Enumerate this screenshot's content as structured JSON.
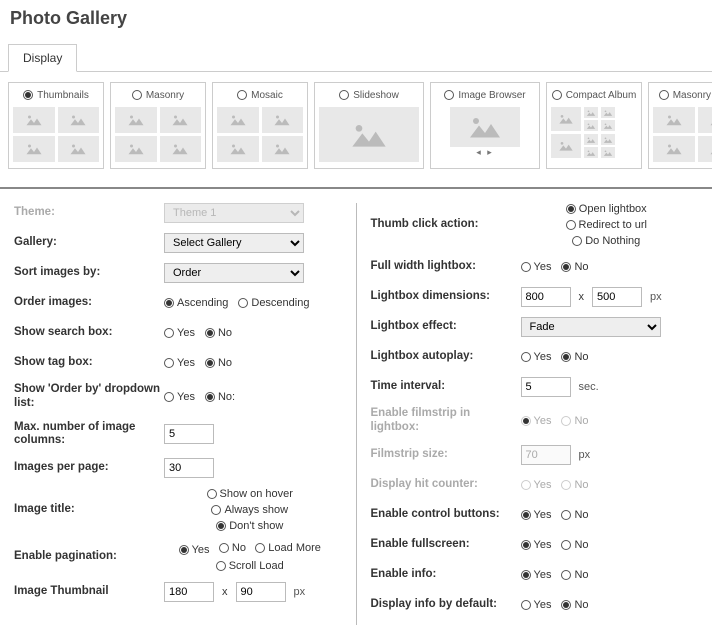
{
  "header": {
    "title": "Photo Gallery"
  },
  "tabs": {
    "display": "Display"
  },
  "views": [
    {
      "label": "Thumbnails",
      "type": "grid",
      "selected": true
    },
    {
      "label": "Masonry",
      "type": "grid",
      "selected": false
    },
    {
      "label": "Mosaic",
      "type": "grid",
      "selected": false
    },
    {
      "label": "Slideshow",
      "type": "slideshow",
      "selected": false
    },
    {
      "label": "Image Browser",
      "type": "browser",
      "selected": false
    },
    {
      "label": "Compact Album",
      "type": "compact",
      "selected": false
    },
    {
      "label": "Masonry Albu",
      "type": "grid",
      "selected": false
    }
  ],
  "left": {
    "theme_label": "Theme:",
    "theme_value": "Theme 1",
    "gallery_label": "Gallery:",
    "gallery_value": "Select Gallery",
    "sort_label": "Sort images by:",
    "sort_value": "Order",
    "order_label": "Order images:",
    "order_asc": "Ascending",
    "order_desc": "Descending",
    "search_label": "Show search box:",
    "tag_label": "Show tag box:",
    "orderby_label": "Show 'Order by' dropdown list:",
    "maxcols_label": "Max. number of image columns:",
    "maxcols_value": "5",
    "perpage_label": "Images per page:",
    "perpage_value": "30",
    "imgtitle_label": "Image title:",
    "imgtitle_hover": "Show on hover",
    "imgtitle_always": "Always show",
    "imgtitle_dont": "Don't show",
    "pagination_label": "Enable pagination:",
    "pagination_loadmore": "Load More",
    "pagination_scroll": "Scroll Load",
    "thumbdim_label": "Image Thumbnail",
    "thumbdim_w": "180",
    "thumbdim_h": "90",
    "yes": "Yes",
    "no": "No",
    "no_colon": "No:",
    "px": "px"
  },
  "right": {
    "click_label": "Thumb click action:",
    "click_open": "Open lightbox",
    "click_redirect": "Redirect to url",
    "click_nothing": "Do Nothing",
    "fullwidth_label": "Full width lightbox:",
    "dim_label": "Lightbox dimensions:",
    "dim_w": "800",
    "dim_h": "500",
    "effect_label": "Lightbox effect:",
    "effect_value": "Fade",
    "autoplay_label": "Lightbox autoplay:",
    "interval_label": "Time interval:",
    "interval_value": "5",
    "sec": "sec.",
    "filmstrip_label": "Enable filmstrip in lightbox:",
    "filmsize_label": "Filmstrip size:",
    "filmsize_value": "70",
    "hit_label": "Display hit counter:",
    "ctrl_label": "Enable control buttons:",
    "fullscreen_label": "Enable fullscreen:",
    "info_label": "Enable info:",
    "infodef_label": "Display info by default:",
    "yes": "Yes",
    "no": "No",
    "px": "px",
    "x": "x"
  }
}
